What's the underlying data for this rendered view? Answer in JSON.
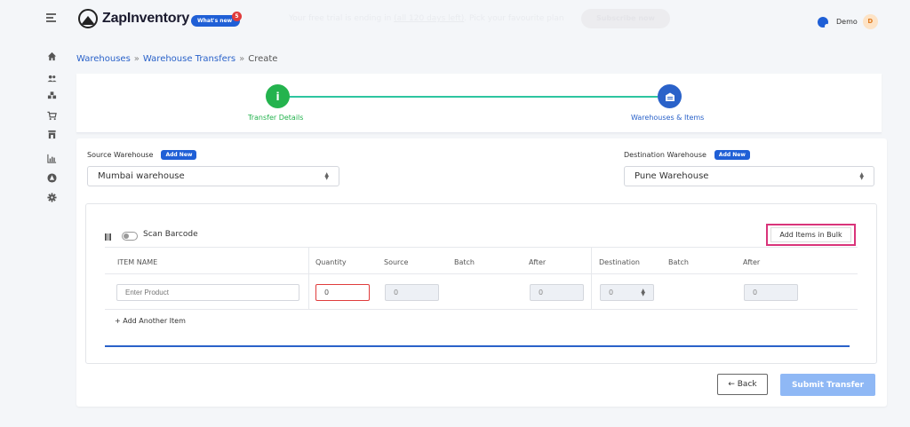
{
  "header": {
    "brand_name": "ZapInventory",
    "whats_new_label": "What's new",
    "whats_new_count": "5",
    "trial_prefix": "Your free trial is ending in ",
    "trial_days": "(all 120 days left)",
    "trial_suffix": ". Pick your favourite plan",
    "subscribe_label": "Subscribe now",
    "user_name": "Demo",
    "avatar_initial": "D"
  },
  "sidebar": {
    "icons": [
      "home-icon",
      "users-icon",
      "warehouse-icon",
      "cart-icon",
      "store-icon",
      "reports-icon",
      "integrations-icon",
      "settings-icon"
    ]
  },
  "breadcrumb": {
    "items": [
      "Warehouses",
      "Warehouse Transfers",
      "Create"
    ],
    "separator": "»"
  },
  "stepper": {
    "step1_icon_text": "i",
    "step1_label": "Transfer Details",
    "step2_label": "Warehouses & Items"
  },
  "form": {
    "source_label": "Source Warehouse",
    "destination_label": "Destination Warehouse",
    "add_new_label": "Add New",
    "source_value": "Mumbai warehouse",
    "destination_value": "Pune Warehouse",
    "scan_barcode_label": "Scan Barcode",
    "add_bulk_label": "Add Items in Bulk",
    "add_another_label": "+ Add Another Item",
    "back_label": "← Back",
    "submit_label": "Submit Transfer"
  },
  "table": {
    "columns": [
      "ITEM NAME",
      "Quantity",
      "Source",
      "Batch",
      "After",
      "Destination",
      "Batch",
      "After"
    ],
    "row": {
      "item_placeholder": "Enter Product",
      "quantity": "0",
      "source": "0",
      "source_after": "0",
      "destination": "0",
      "destination_after": "0"
    }
  },
  "colors": {
    "primary": "#1f5fd6",
    "success": "#24b34e",
    "highlight": "#d9347a",
    "error": "#e03c3c"
  }
}
